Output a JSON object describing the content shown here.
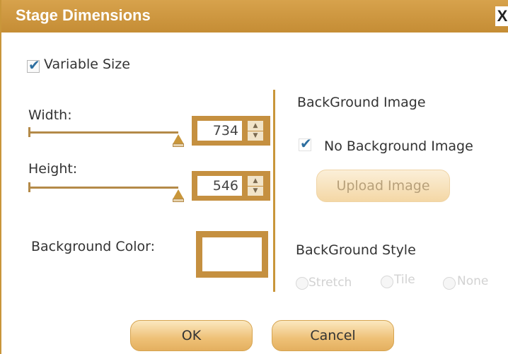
{
  "dialog": {
    "title": "Stage Dimensions",
    "close_label": "X"
  },
  "variable_size": {
    "label": "Variable Size",
    "checked": true
  },
  "width": {
    "label": "Width:",
    "value": "734"
  },
  "height": {
    "label": "Height:",
    "value": "546"
  },
  "background_color": {
    "label": "Background Color:",
    "value": "#ffffff"
  },
  "background_image": {
    "heading": "BackGround Image",
    "no_image_label": "No Background Image",
    "no_image_checked": true,
    "upload_label": "Upload Image"
  },
  "background_style": {
    "heading": "BackGround Style",
    "options": [
      "Stretch",
      "Tile",
      "None"
    ]
  },
  "buttons": {
    "ok": "OK",
    "cancel": "Cancel"
  },
  "colors": {
    "accent": "#c59040",
    "title_bar": "#d7a24c"
  }
}
